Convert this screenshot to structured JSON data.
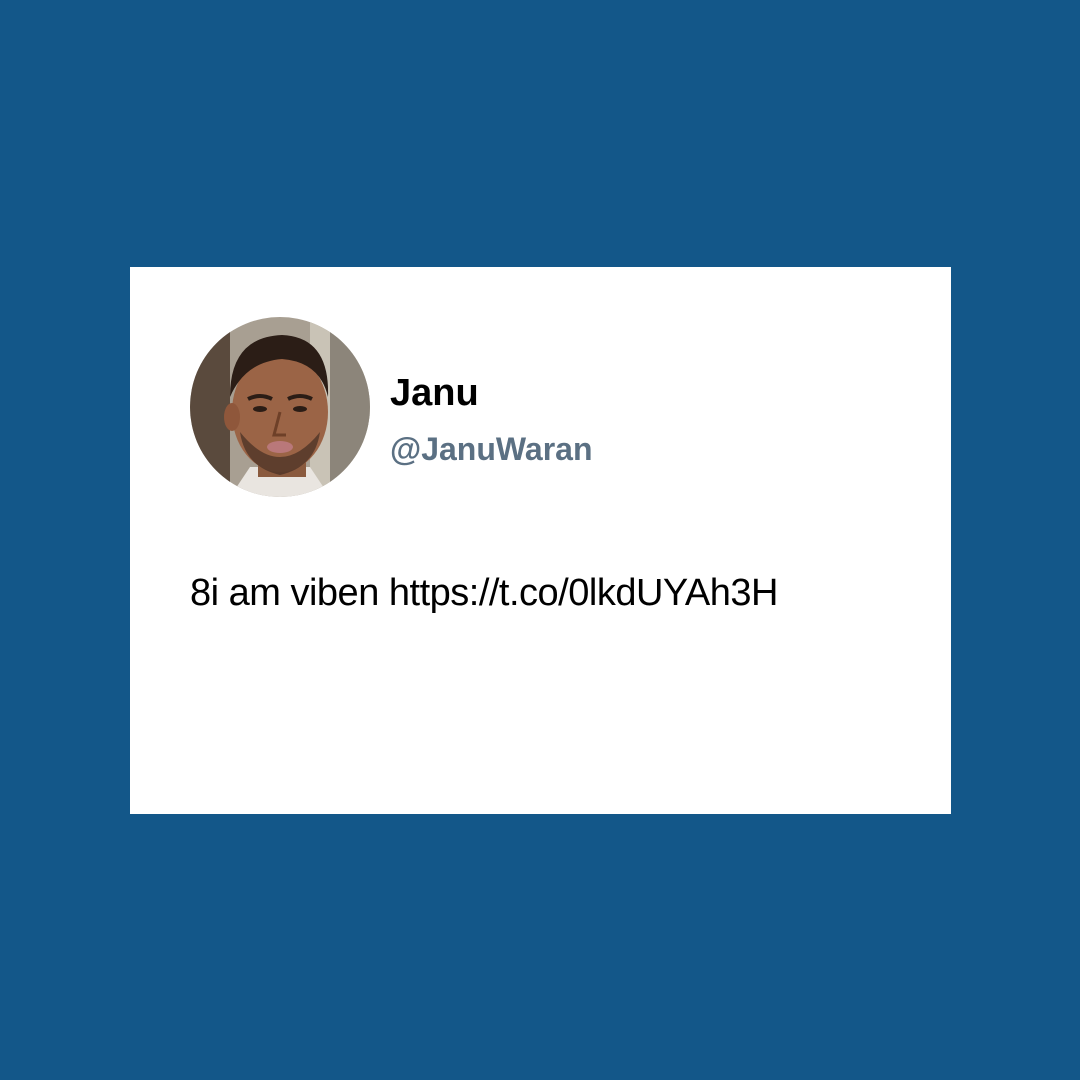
{
  "colors": {
    "background": "#135789",
    "card": "#ffffff",
    "name_text": "#000000",
    "handle_text": "#5b7083"
  },
  "tweet": {
    "author": {
      "display_name": "Janu",
      "handle": "@JanuWaran",
      "avatar": "profile-photo"
    },
    "text": "8i am viben https://t.co/0lkdUYAh3H"
  }
}
